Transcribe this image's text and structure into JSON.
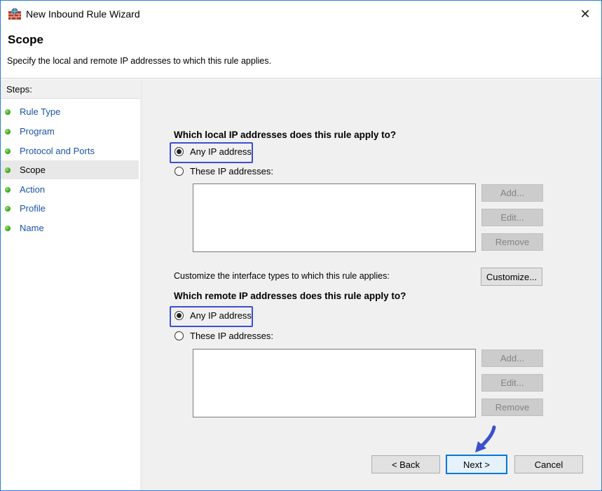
{
  "window": {
    "title": "New Inbound Rule Wizard",
    "close_glyph": "✕"
  },
  "header": {
    "title": "Scope",
    "subtitle": "Specify the local and remote IP addresses to which this rule applies."
  },
  "steps": {
    "label": "Steps:",
    "items": [
      {
        "label": "Rule Type",
        "active": false
      },
      {
        "label": "Program",
        "active": false
      },
      {
        "label": "Protocol and Ports",
        "active": false
      },
      {
        "label": "Scope",
        "active": true
      },
      {
        "label": "Action",
        "active": false
      },
      {
        "label": "Profile",
        "active": false
      },
      {
        "label": "Name",
        "active": false
      }
    ]
  },
  "local": {
    "question": "Which local IP addresses does this rule apply to?",
    "option_any": "Any IP address",
    "option_these": "These IP addresses:",
    "selected": "any",
    "add_label": "Add...",
    "edit_label": "Edit...",
    "remove_label": "Remove"
  },
  "customize": {
    "text": "Customize the interface types to which this rule applies:",
    "button_label": "Customize..."
  },
  "remote": {
    "question": "Which remote IP addresses does this rule apply to?",
    "option_any": "Any IP address",
    "option_these": "These IP addresses:",
    "selected": "any",
    "add_label": "Add...",
    "edit_label": "Edit...",
    "remove_label": "Remove"
  },
  "footer": {
    "back_label": "< Back",
    "next_label": "Next >",
    "cancel_label": "Cancel"
  },
  "colors": {
    "highlight": "#3b4fd0",
    "pointer_arrow": "#3b4fd0",
    "step_link": "#1b52a8"
  }
}
